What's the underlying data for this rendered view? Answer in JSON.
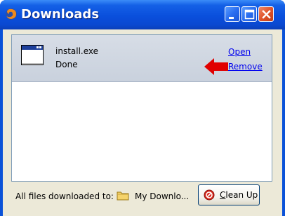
{
  "window": {
    "title": "Downloads",
    "controls": [
      "minimize-icon",
      "maximize-icon",
      "close-icon"
    ]
  },
  "downloads": [
    {
      "file_name": "install.exe",
      "status": "Done",
      "icon": "application-window-icon",
      "actions": {
        "open": "Open",
        "remove": "Remove"
      }
    }
  ],
  "annotation": {
    "icon": "red-arrow-icon",
    "color": "#e00000"
  },
  "footer": {
    "label": "All files downloaded to:",
    "folder_icon": "folder-icon",
    "folder_name": "My Downlo...",
    "cleanup_button": {
      "label_first": "C",
      "label_rest": "lean Up",
      "icon": "cleanup-icon"
    }
  },
  "colors": {
    "titlebar": "#0a4fdc",
    "item_background": "#c9d1dd",
    "link": "#0000ee",
    "window_face": "#ece9d8"
  }
}
